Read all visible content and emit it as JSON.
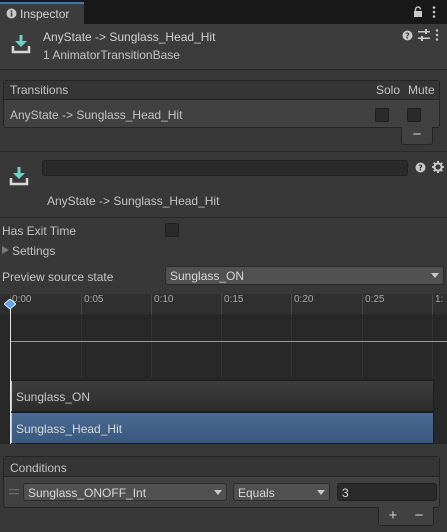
{
  "tab": {
    "label": "Inspector"
  },
  "header": {
    "title": "AnyState -> Sunglass_Head_Hit",
    "subtitle": "1 AnimatorTransitionBase"
  },
  "transitions": {
    "title": "Transitions",
    "solo_label": "Solo",
    "mute_label": "Mute",
    "rows": [
      {
        "label": "AnyState -> Sunglass_Head_Hit",
        "solo": false,
        "mute": false
      }
    ],
    "remove_label": "−"
  },
  "transition": {
    "name_value": "",
    "title": "AnyState -> Sunglass_Head_Hit"
  },
  "settings": {
    "has_exit_time_label": "Has Exit Time",
    "has_exit_time": false,
    "settings_label": "Settings",
    "preview_label": "Preview source state",
    "preview_value": "Sunglass_ON"
  },
  "timeline": {
    "ticks": [
      "0:00",
      "0:05",
      "0:10",
      "0:15",
      "0:20",
      "0:25",
      "1:"
    ],
    "state_a": "Sunglass_ON",
    "state_b": "Sunglass_Head_Hit"
  },
  "conditions": {
    "title": "Conditions",
    "rows": [
      {
        "parameter": "Sunglass_ONOFF_Int",
        "mode": "Equals",
        "value": "3"
      }
    ],
    "add_label": "+",
    "remove_label": "−"
  },
  "colors": {
    "accent": "#3a79bb",
    "selected_state": "#3f5f89",
    "icon_teal": "#2fb3a8"
  }
}
